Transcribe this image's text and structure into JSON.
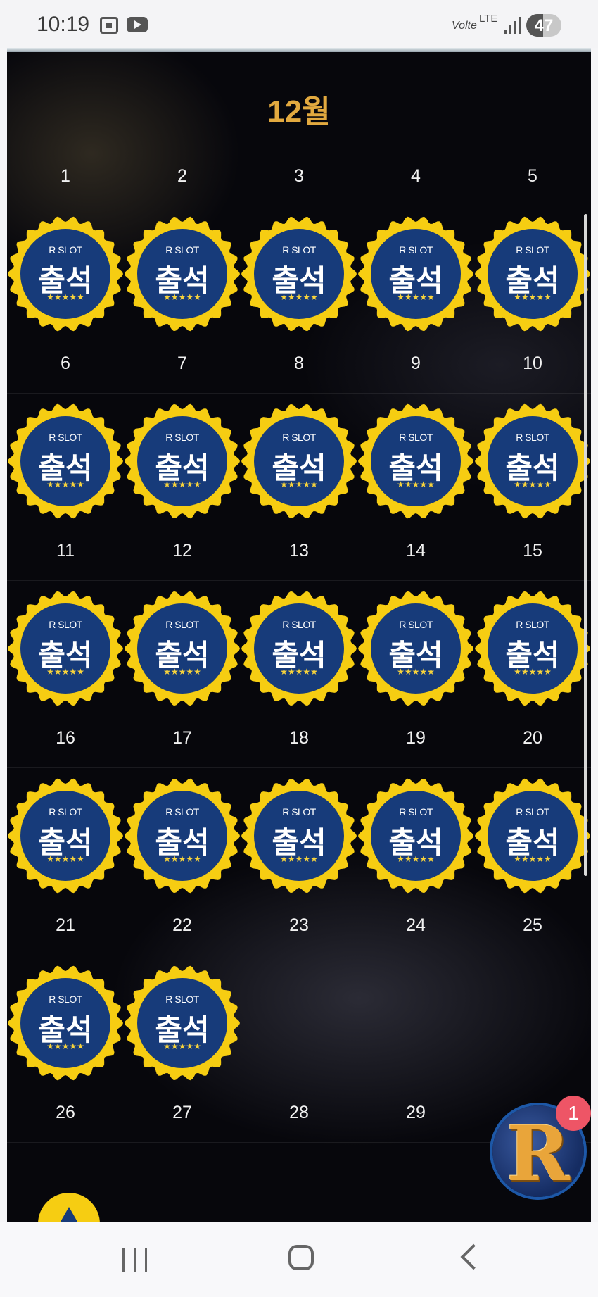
{
  "status_bar": {
    "time": "10:19",
    "network_volte": "Volte",
    "network_lte": "LTE",
    "battery": "47",
    "battery_level": 0.47
  },
  "calendar": {
    "month_title": "12월",
    "days": [
      "1",
      "2",
      "3",
      "4",
      "5",
      "6",
      "7",
      "8",
      "9",
      "10",
      "11",
      "12",
      "13",
      "14",
      "15",
      "16",
      "17",
      "18",
      "19",
      "20",
      "21",
      "22",
      "23",
      "24",
      "25",
      "26",
      "27",
      "28",
      "29"
    ],
    "stamp_brand": "R SLOT",
    "stamp_text": "출석",
    "stamp_stars": "★★★★★",
    "stamped_days": 22
  },
  "floating": {
    "notification_count": "1",
    "logo_letter": "R"
  },
  "colors": {
    "month_title": "#e2a93f",
    "stamp_ring": "#f6cd12",
    "stamp_fill": "#173b7a",
    "background": "#07070c"
  }
}
